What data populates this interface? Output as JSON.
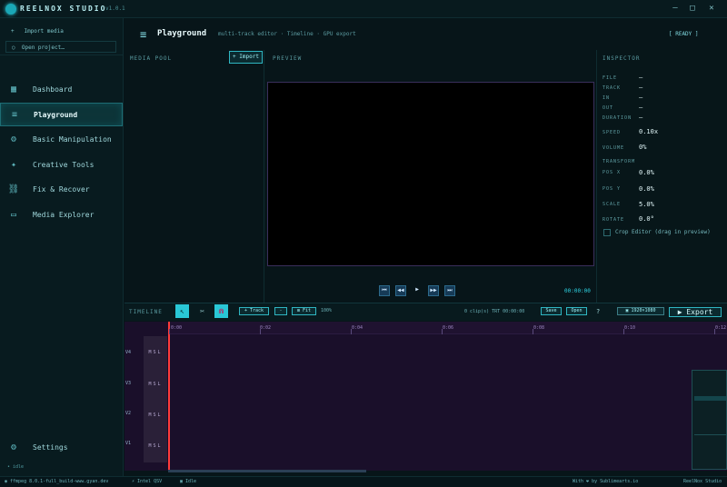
{
  "app": {
    "title": "REELNOX STUDIO",
    "version": "v1.0.1",
    "window_controls": [
      "—",
      "□",
      "✕"
    ]
  },
  "sidebar": {
    "quick": [
      "Import media",
      "Open project…"
    ],
    "quick_icons": [
      "+",
      "○"
    ],
    "items": [
      {
        "label": "Dashboard",
        "icon": "▦"
      },
      {
        "label": "Playground",
        "icon": "≡"
      },
      {
        "label": "Basic Manipulation",
        "icon": "⚙"
      },
      {
        "label": "Creative Tools",
        "icon": "✦"
      },
      {
        "label": "Fix & Recover",
        "icon": "⛓"
      },
      {
        "label": "Media Explorer",
        "icon": "▭"
      }
    ],
    "settings": {
      "label": "Settings",
      "icon": "⚙"
    },
    "idle_label": "• idle"
  },
  "header": {
    "icon": "≡",
    "title": "Playground",
    "subtitle": "multi-track editor · Timeline · GPU export",
    "status": "[ READY ]"
  },
  "media_pool": {
    "label": "MEDIA POOL",
    "import_label": "+ Import"
  },
  "preview": {
    "label": "PREVIEW",
    "timecode": "00:00:00",
    "transport": [
      "⏮",
      "◀◀",
      "▶",
      "▶▶",
      "⏭"
    ]
  },
  "inspector": {
    "label": "INSPECTOR",
    "rows": [
      {
        "key": "FILE",
        "value": "—"
      },
      {
        "key": "TRACK",
        "value": "—"
      },
      {
        "key": "IN",
        "value": "—"
      },
      {
        "key": "OUT",
        "value": "—"
      },
      {
        "key": "DURATION",
        "value": "—"
      },
      {
        "key": "SPEED",
        "value": "0.10x"
      },
      {
        "key": "VOLUME",
        "value": "0%"
      },
      {
        "key": "TRANSFORM",
        "value": ""
      },
      {
        "key": "POS X",
        "value": "0.0%"
      },
      {
        "key": "POS Y",
        "value": "0.0%"
      },
      {
        "key": "SCALE",
        "value": "5.0%"
      },
      {
        "key": "ROTATE",
        "value": "0.0°"
      }
    ],
    "crop_label": "Crop Editor (drag in preview)"
  },
  "timeline": {
    "label": "TIMELINE",
    "add_track": "+ Track",
    "minus": "-",
    "fit": "⊞ Fit",
    "zoom": "100%",
    "clips_info": "0 clip(s)  TRT 00:00:00",
    "save": "Save",
    "open": "Open",
    "help": "?",
    "resolution": "▣ 1920×1080",
    "export": "▶ Export",
    "ruler": [
      "0:00",
      "0:02",
      "0:04",
      "0:06",
      "0:08",
      "0:10",
      "0:12"
    ],
    "tracks": [
      "V4",
      "V3",
      "V2",
      "V1"
    ],
    "msl": "MSL"
  },
  "statusbar": {
    "ffmpeg": "◉ ffmpeg 8.0.1-full_build-www.gyan.dev",
    "gpu": "⚡ Intel QSV",
    "state": "▣ Idle",
    "credit": "With ❤ by Sublimearts.io",
    "app": "ReelNox Studio"
  }
}
